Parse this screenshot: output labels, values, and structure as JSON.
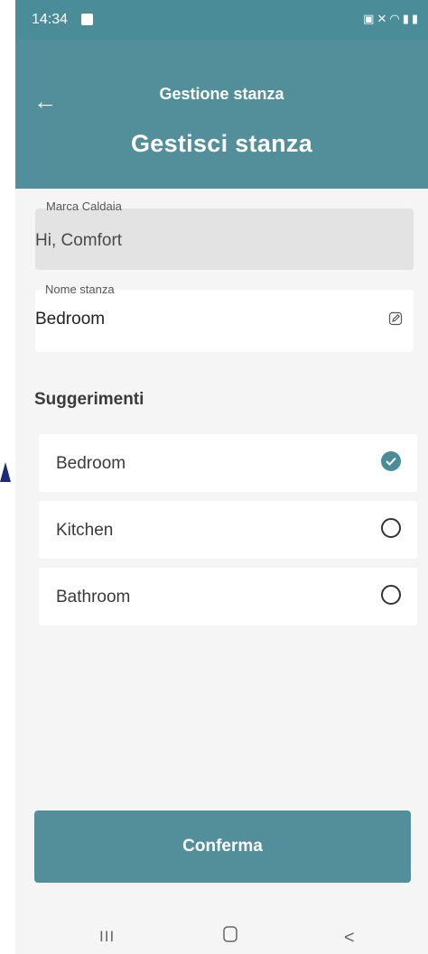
{
  "status_bar": {
    "time": "14:34",
    "icons": [
      "photo-icon",
      "mute-icon",
      "wifi-icon",
      "signal-icon",
      "battery-icon"
    ]
  },
  "header": {
    "title": "Gestione stanza",
    "heading": "Gestisci stanza"
  },
  "fields": {
    "brand": {
      "label": "Marca Caldaia",
      "value": "Hi, Comfort"
    },
    "room_name": {
      "label": "Nome stanza",
      "value": "Bedroom"
    }
  },
  "suggestions": {
    "title": "Suggerimenti",
    "items": [
      {
        "label": "Bedroom",
        "selected": true
      },
      {
        "label": "Kitchen",
        "selected": false
      },
      {
        "label": "Bathroom",
        "selected": false
      }
    ]
  },
  "confirm_label": "Conferma",
  "navbar": {
    "recent": "III",
    "home": "▢",
    "back": "<"
  },
  "colors": {
    "primary": "#528f9b",
    "status_bar": "#4a8c97",
    "background": "#f5f5f5"
  }
}
